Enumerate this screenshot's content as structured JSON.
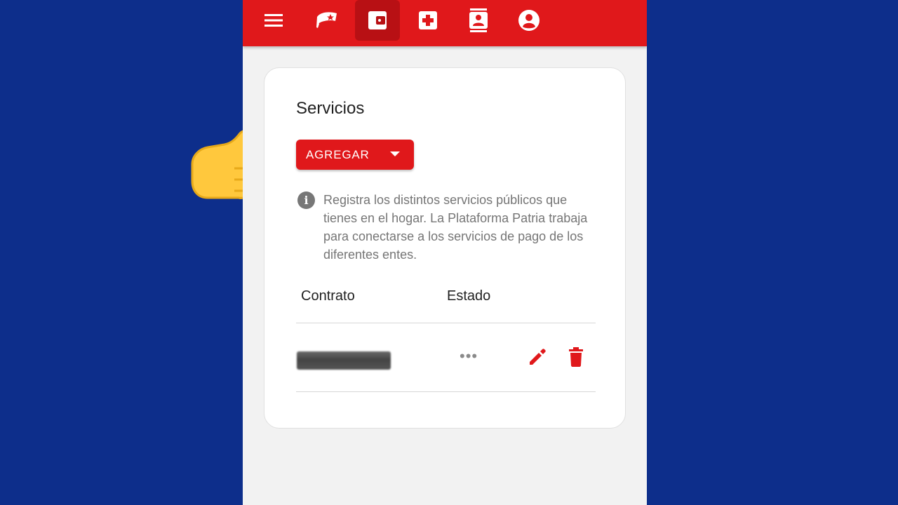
{
  "nav": {
    "items": [
      {
        "name": "menu-icon",
        "active": false
      },
      {
        "name": "flag-cap-icon",
        "active": false
      },
      {
        "name": "wallet-icon",
        "active": true
      },
      {
        "name": "health-cross-icon",
        "active": false
      },
      {
        "name": "contact-card-icon",
        "active": false
      },
      {
        "name": "account-circle-icon",
        "active": false
      }
    ]
  },
  "card": {
    "title": "Servicios",
    "add_button_label": "AGREGAR",
    "info_text": "Registra los distintos servicios públicos que tienes en el hogar. La Plataforma Patria trabaja para conectarse a los servicios de pago de los diferentes entes.",
    "columns": [
      "Contrato",
      "Estado"
    ],
    "rows": [
      {
        "contract": "",
        "status": "•••"
      }
    ]
  },
  "colors": {
    "background": "#0d2e8b",
    "accent": "#e0181b",
    "accent_active": "#b81014",
    "page": "#f2f2f2",
    "muted_text": "#757575"
  }
}
